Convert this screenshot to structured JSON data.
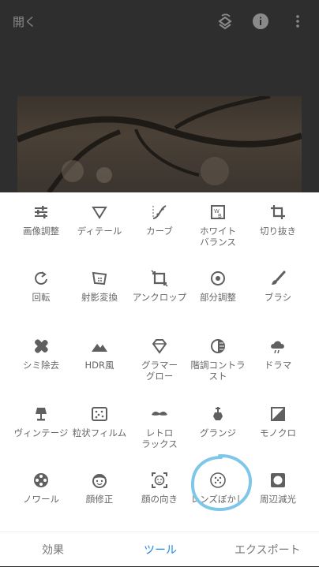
{
  "header": {
    "open_label": "開く"
  },
  "tools": [
    {
      "label": "画像調整",
      "icon": "sliders-icon"
    },
    {
      "label": "ディテール",
      "icon": "triangle-down-icon"
    },
    {
      "label": "カーブ",
      "icon": "curve-icon"
    },
    {
      "label": "ホワイト\nバランス",
      "icon": "white-balance-icon"
    },
    {
      "label": "切り抜き",
      "icon": "crop-icon"
    },
    {
      "label": "回転",
      "icon": "rotate-icon"
    },
    {
      "label": "射影変換",
      "icon": "perspective-icon"
    },
    {
      "label": "アンクロップ",
      "icon": "expand-icon"
    },
    {
      "label": "部分調整",
      "icon": "selective-icon"
    },
    {
      "label": "ブラシ",
      "icon": "brush-icon"
    },
    {
      "label": "シミ除去",
      "icon": "bandage-icon"
    },
    {
      "label": "HDR風",
      "icon": "mountain-icon"
    },
    {
      "label": "グラマー\nグロー",
      "icon": "diamond-icon"
    },
    {
      "label": "階調コントラ\nスト",
      "icon": "tonal-icon"
    },
    {
      "label": "ドラマ",
      "icon": "cloud-icon"
    },
    {
      "label": "ヴィンテージ",
      "icon": "lamp-icon"
    },
    {
      "label": "粒状フィルム",
      "icon": "grain-icon"
    },
    {
      "label": "レトロ\nラックス",
      "icon": "mustache-icon"
    },
    {
      "label": "グランジ",
      "icon": "guitar-icon"
    },
    {
      "label": "モノクロ",
      "icon": "monochrome-icon"
    },
    {
      "label": "ノワール",
      "icon": "film-reel-icon"
    },
    {
      "label": "顔修正",
      "icon": "face-icon"
    },
    {
      "label": "顔の向き",
      "icon": "face-pose-icon"
    },
    {
      "label": "レンズぼかし",
      "icon": "lens-blur-icon"
    },
    {
      "label": "周辺減光",
      "icon": "vignette-icon"
    }
  ],
  "tabs": {
    "effects": "効果",
    "tools": "ツール",
    "export": "エクスポート"
  },
  "colors": {
    "accent": "#1e88e5",
    "highlight_circle": "#7fc7e8"
  }
}
